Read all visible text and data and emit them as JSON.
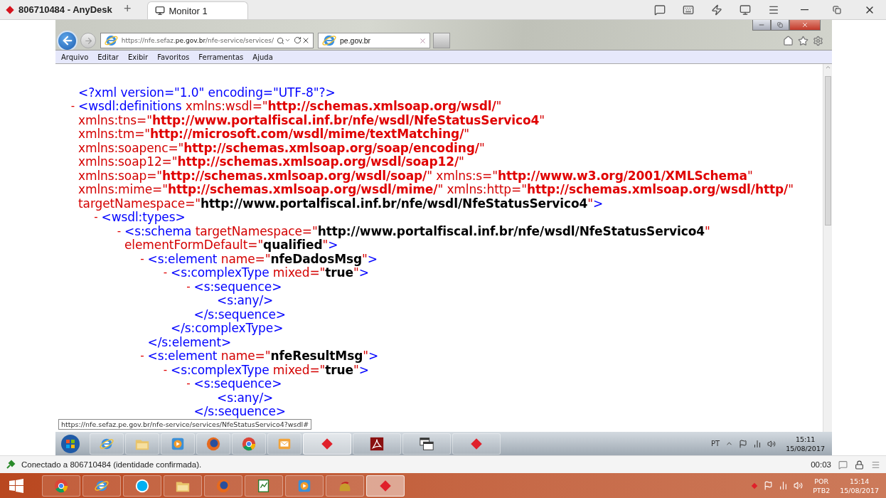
{
  "anydesk": {
    "title": "806710484 - AnyDesk",
    "new_tab": "+",
    "tabs": [
      {
        "label": "Monitor 1",
        "selected": true
      }
    ]
  },
  "browser": {
    "address": "https://nfe.sefaz.**pe.gov.br**/nfe-service/services/",
    "tabs": [
      {
        "label": "pe.gov.br",
        "selected": true
      }
    ],
    "menu": [
      "Arquivo",
      "Editar",
      "Exibir",
      "Favoritos",
      "Ferramentas",
      "Ajuda"
    ],
    "status_url": "https://nfe.sefaz.pe.gov.br/nfe-service/services/NfeStatusServico4?wsdl#"
  },
  "xml": [
    {
      "lines": [
        [
          {
            "kind": "tag",
            "text": "<?xml version=\"1.0\" encoding=\"UTF-8\"?>"
          }
        ]
      ]
    },
    {
      "toggle": "-",
      "lines": [
        [
          {
            "kind": "tag",
            "text": "<wsdl:definitions "
          },
          {
            "kind": "attr",
            "text": "xmlns:wsdl=\""
          },
          {
            "kind": "nsval",
            "text": "http://schemas.xmlsoap.org/wsdl/"
          },
          {
            "kind": "attr",
            "text": "\""
          }
        ],
        [
          {
            "kind": "attr",
            "text": "xmlns:tns=\""
          },
          {
            "kind": "nsval",
            "text": "http://www.portalfiscal.inf.br/nfe/wsdl/NfeStatusServico4"
          },
          {
            "kind": "attr",
            "text": "\""
          }
        ],
        [
          {
            "kind": "attr",
            "text": "xmlns:tm=\""
          },
          {
            "kind": "nsval",
            "text": "http://microsoft.com/wsdl/mime/textMatching/"
          },
          {
            "kind": "attr",
            "text": "\""
          }
        ],
        [
          {
            "kind": "attr",
            "text": "xmlns:soapenc=\""
          },
          {
            "kind": "nsval",
            "text": "http://schemas.xmlsoap.org/soap/encoding/"
          },
          {
            "kind": "attr",
            "text": "\""
          }
        ],
        [
          {
            "kind": "attr",
            "text": "xmlns:soap12=\""
          },
          {
            "kind": "nsval",
            "text": "http://schemas.xmlsoap.org/wsdl/soap12/"
          },
          {
            "kind": "attr",
            "text": "\""
          }
        ],
        [
          {
            "kind": "attr",
            "text": "xmlns:soap=\""
          },
          {
            "kind": "nsval",
            "text": "http://schemas.xmlsoap.org/wsdl/soap/"
          },
          {
            "kind": "attr",
            "text": "\" xmlns:s=\""
          },
          {
            "kind": "nsval",
            "text": "http://www.w3.org/2001/XMLSchema"
          },
          {
            "kind": "attr",
            "text": "\""
          }
        ],
        [
          {
            "kind": "attr",
            "text": "xmlns:mime=\""
          },
          {
            "kind": "nsval",
            "text": "http://schemas.xmlsoap.org/wsdl/mime/"
          },
          {
            "kind": "attr",
            "text": "\" xmlns:http=\""
          },
          {
            "kind": "nsval",
            "text": "http://schemas.xmlsoap.org/wsdl/http/"
          },
          {
            "kind": "attr",
            "text": "\""
          }
        ],
        [
          {
            "kind": "attr",
            "text": "targetNamespace=\""
          },
          {
            "kind": "val",
            "text": "http://www.portalfiscal.inf.br/nfe/wsdl/NfeStatusServico4"
          },
          {
            "kind": "attr",
            "text": "\""
          },
          {
            "kind": "tag",
            "text": ">"
          }
        ]
      ],
      "children": [
        {
          "toggle": "-",
          "lines": [
            [
              {
                "kind": "tag",
                "text": "<wsdl:types>"
              }
            ]
          ],
          "children": [
            {
              "toggle": "-",
              "lines": [
                [
                  {
                    "kind": "tag",
                    "text": "<s:schema "
                  },
                  {
                    "kind": "attr",
                    "text": "targetNamespace=\""
                  },
                  {
                    "kind": "val",
                    "text": "http://www.portalfiscal.inf.br/nfe/wsdl/NfeStatusServico4"
                  },
                  {
                    "kind": "attr",
                    "text": "\""
                  }
                ],
                [
                  {
                    "kind": "attr",
                    "text": "elementFormDefault=\""
                  },
                  {
                    "kind": "val",
                    "text": "qualified"
                  },
                  {
                    "kind": "attr",
                    "text": "\""
                  },
                  {
                    "kind": "tag",
                    "text": ">"
                  }
                ]
              ],
              "children": [
                {
                  "toggle": "-",
                  "lines": [
                    [
                      {
                        "kind": "tag",
                        "text": "<s:element "
                      },
                      {
                        "kind": "attr",
                        "text": "name=\""
                      },
                      {
                        "kind": "val",
                        "text": "nfeDadosMsg"
                      },
                      {
                        "kind": "attr",
                        "text": "\""
                      },
                      {
                        "kind": "tag",
                        "text": ">"
                      }
                    ]
                  ],
                  "close": "</s:element>",
                  "children": [
                    {
                      "toggle": "-",
                      "lines": [
                        [
                          {
                            "kind": "tag",
                            "text": "<s:complexType "
                          },
                          {
                            "kind": "attr",
                            "text": "mixed=\""
                          },
                          {
                            "kind": "val",
                            "text": "true"
                          },
                          {
                            "kind": "attr",
                            "text": "\""
                          },
                          {
                            "kind": "tag",
                            "text": ">"
                          }
                        ]
                      ],
                      "close": "</s:complexType>",
                      "children": [
                        {
                          "toggle": "-",
                          "lines": [
                            [
                              {
                                "kind": "tag",
                                "text": "<s:sequence>"
                              }
                            ]
                          ],
                          "close": "</s:sequence>",
                          "children": [
                            {
                              "lines": [
                                [
                                  {
                                    "kind": "tag",
                                    "text": "<s:any/>"
                                  }
                                ]
                              ]
                            }
                          ]
                        }
                      ]
                    }
                  ]
                },
                {
                  "toggle": "-",
                  "lines": [
                    [
                      {
                        "kind": "tag",
                        "text": "<s:element "
                      },
                      {
                        "kind": "attr",
                        "text": "name=\""
                      },
                      {
                        "kind": "val",
                        "text": "nfeResultMsg"
                      },
                      {
                        "kind": "attr",
                        "text": "\""
                      },
                      {
                        "kind": "tag",
                        "text": ">"
                      }
                    ]
                  ],
                  "children": [
                    {
                      "toggle": "-",
                      "lines": [
                        [
                          {
                            "kind": "tag",
                            "text": "<s:complexType "
                          },
                          {
                            "kind": "attr",
                            "text": "mixed=\""
                          },
                          {
                            "kind": "val",
                            "text": "true"
                          },
                          {
                            "kind": "attr",
                            "text": "\""
                          },
                          {
                            "kind": "tag",
                            "text": ">"
                          }
                        ]
                      ],
                      "children": [
                        {
                          "toggle": "-",
                          "lines": [
                            [
                              {
                                "kind": "tag",
                                "text": "<s:sequence>"
                              }
                            ]
                          ],
                          "close": "</s:sequence>",
                          "children": [
                            {
                              "lines": [
                                [
                                  {
                                    "kind": "tag",
                                    "text": "<s:any/>"
                                  }
                                ]
                              ]
                            }
                          ]
                        }
                      ]
                    }
                  ]
                }
              ]
            }
          ]
        }
      ]
    }
  ],
  "remote_taskbar": {
    "apps": [
      {
        "kind": "ie",
        "selected": false
      },
      {
        "kind": "explorer",
        "selected": false
      },
      {
        "kind": "media",
        "selected": false
      },
      {
        "kind": "firefox",
        "selected": false
      },
      {
        "kind": "chrome",
        "selected": false
      },
      {
        "kind": "outlook",
        "selected": false
      },
      {
        "kind": "anydesk",
        "selected": true
      },
      {
        "kind": "pdf",
        "selected": false
      },
      {
        "kind": "window",
        "selected": false
      },
      {
        "kind": "anydesk",
        "selected": false
      }
    ],
    "language": "PT",
    "time": "15:11",
    "date": "15/08/2017"
  },
  "anydesk_status": {
    "text": "Conectado a 806710484 (identidade confirmada).",
    "timer": "00:03"
  },
  "taskbar": {
    "apps": [
      {
        "kind": "chrome",
        "selected": false
      },
      {
        "kind": "ie",
        "selected": false
      },
      {
        "kind": "skype",
        "selected": false
      },
      {
        "kind": "explorer",
        "selected": false
      },
      {
        "kind": "firefox",
        "selected": false
      },
      {
        "kind": "editor",
        "selected": false
      },
      {
        "kind": "media",
        "selected": false
      },
      {
        "kind": "helmet",
        "selected": false
      },
      {
        "kind": "anydesk",
        "selected": true
      }
    ],
    "language": "POR",
    "layout": "PTB2",
    "time": "15:14",
    "date": "15/08/2017"
  }
}
